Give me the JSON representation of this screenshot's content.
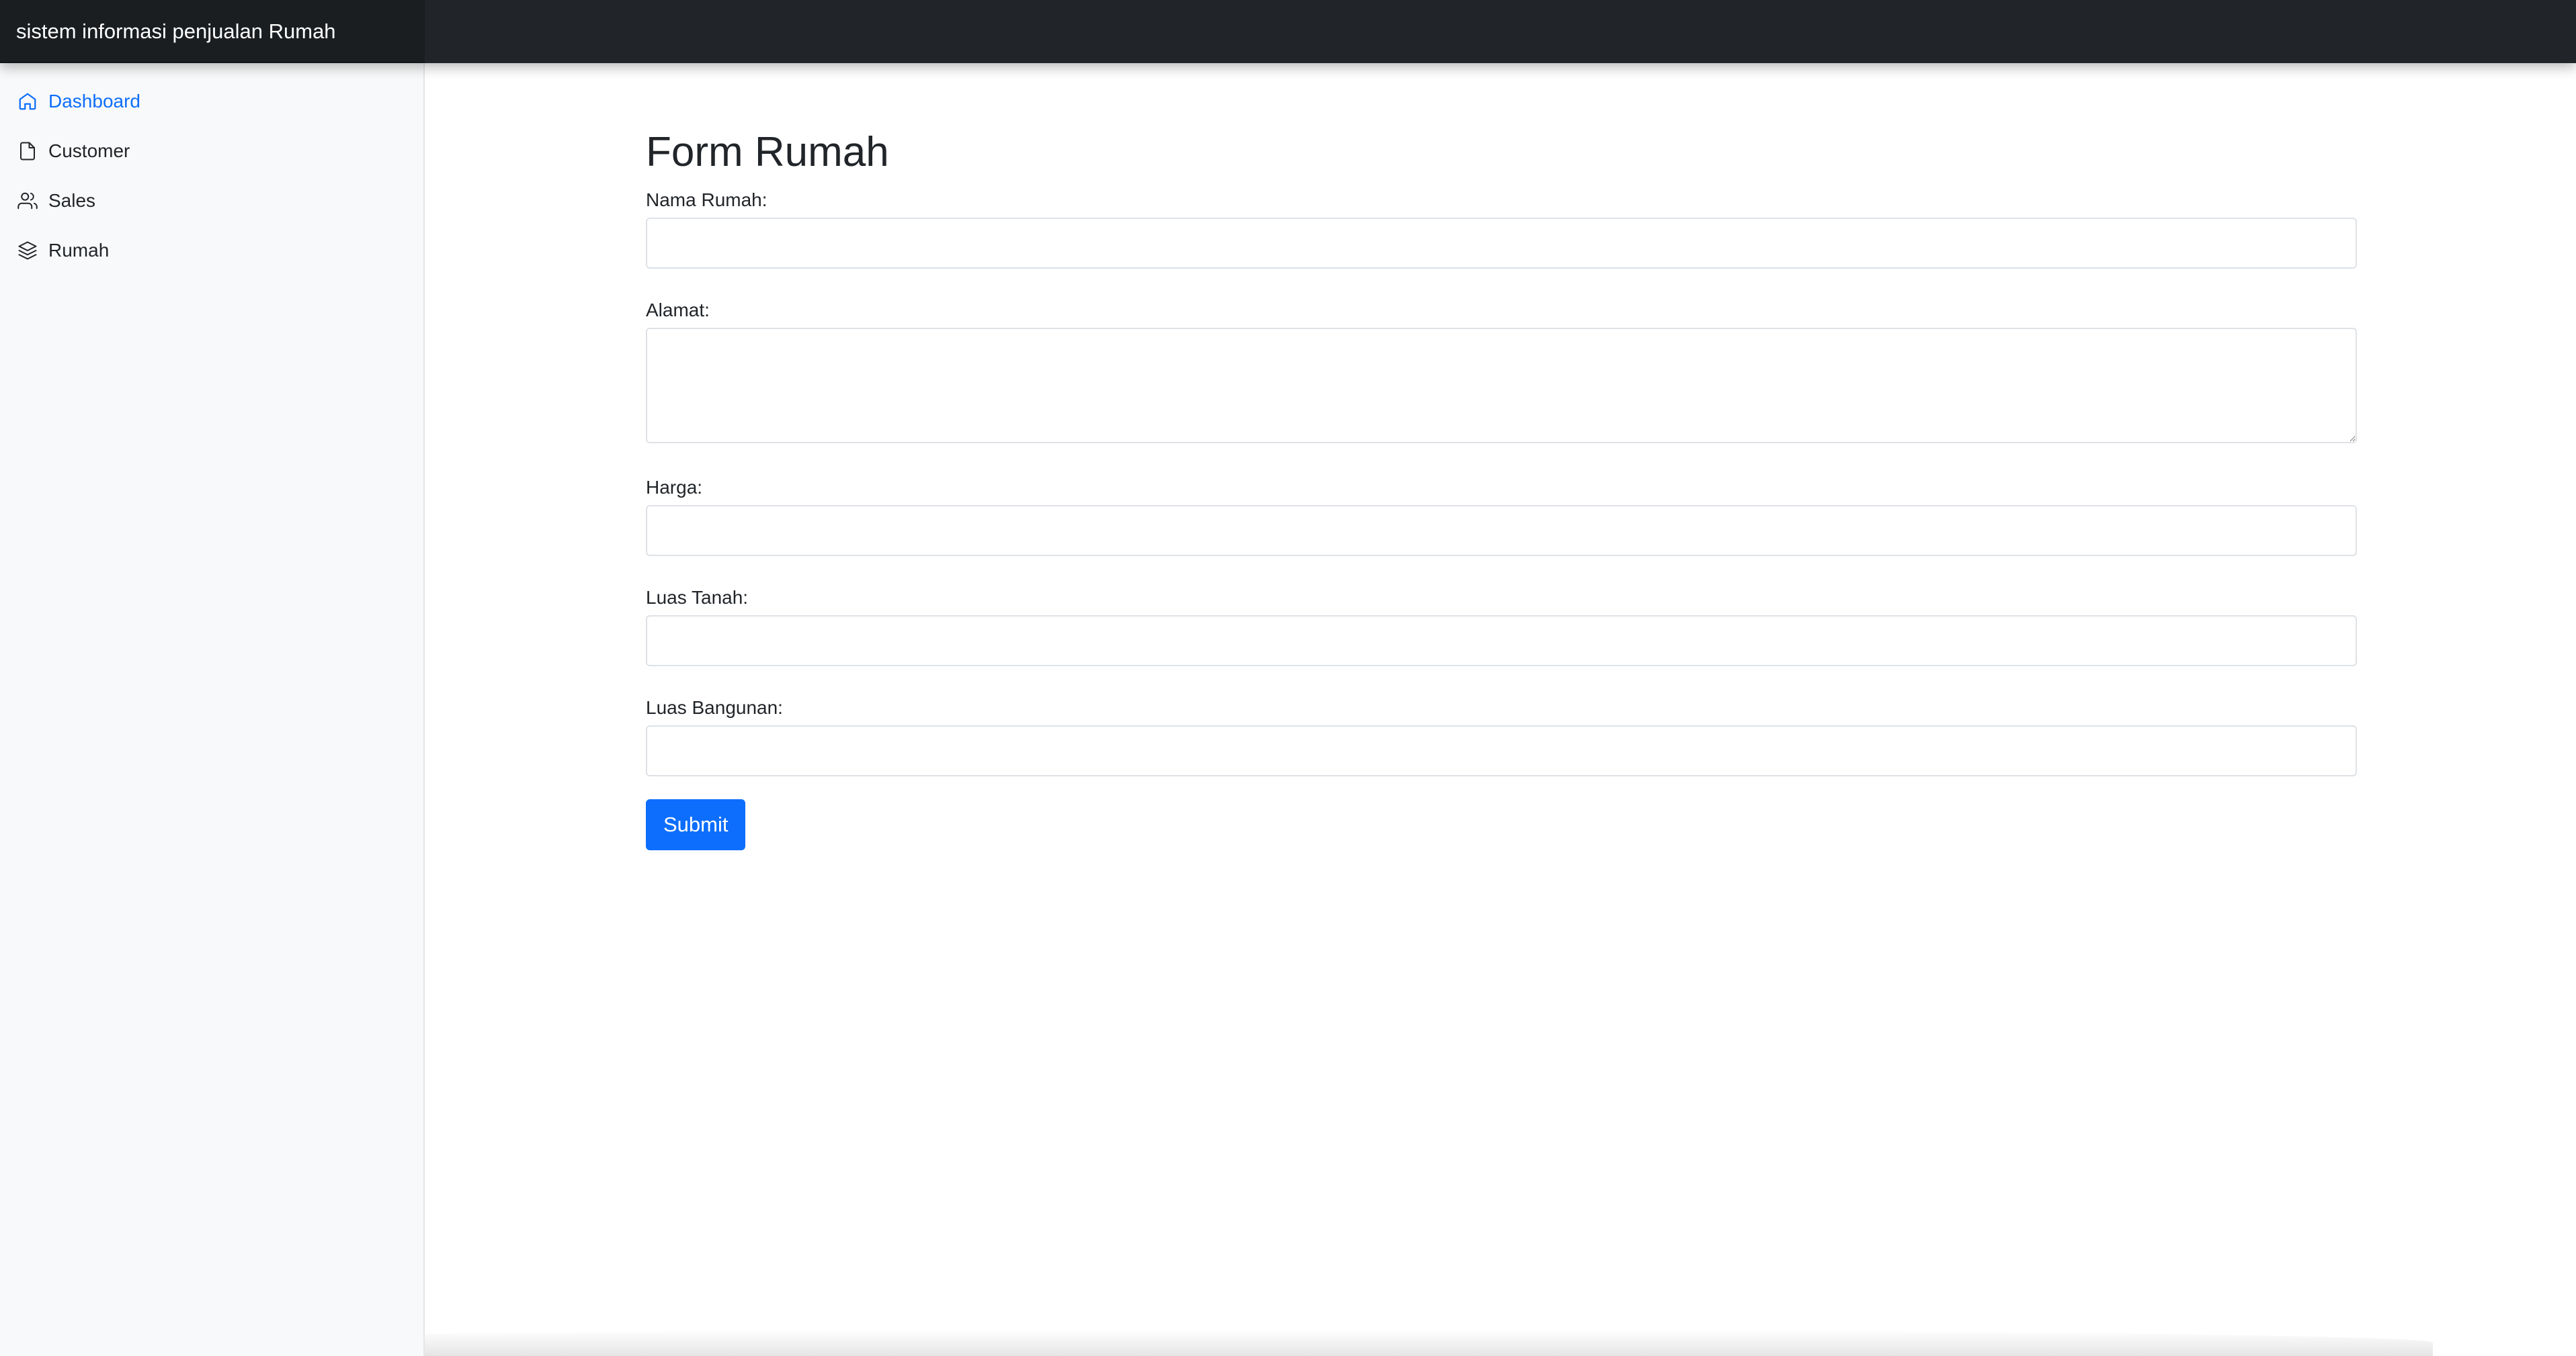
{
  "app": {
    "title": "sistem informasi penjualan Rumah"
  },
  "sidebar": {
    "items": [
      {
        "label": "Dashboard",
        "icon": "home-icon",
        "active": true
      },
      {
        "label": "Customer",
        "icon": "file-icon",
        "active": false
      },
      {
        "label": "Sales",
        "icon": "users-icon",
        "active": false
      },
      {
        "label": "Rumah",
        "icon": "layers-icon",
        "active": false
      }
    ]
  },
  "form": {
    "title": "Form Rumah",
    "fields": {
      "nama_rumah": {
        "label": "Nama Rumah:",
        "value": ""
      },
      "alamat": {
        "label": "Alamat:",
        "value": ""
      },
      "harga": {
        "label": "Harga:",
        "value": ""
      },
      "luas_tanah": {
        "label": "Luas Tanah:",
        "value": ""
      },
      "luas_bangunan": {
        "label": "Luas Bangunan:",
        "value": ""
      }
    },
    "submit_label": "Submit"
  },
  "colors": {
    "topbar": "#212529",
    "sidebar_bg": "#f8f9fa",
    "accent": "#0d6efd",
    "text": "#212529"
  }
}
